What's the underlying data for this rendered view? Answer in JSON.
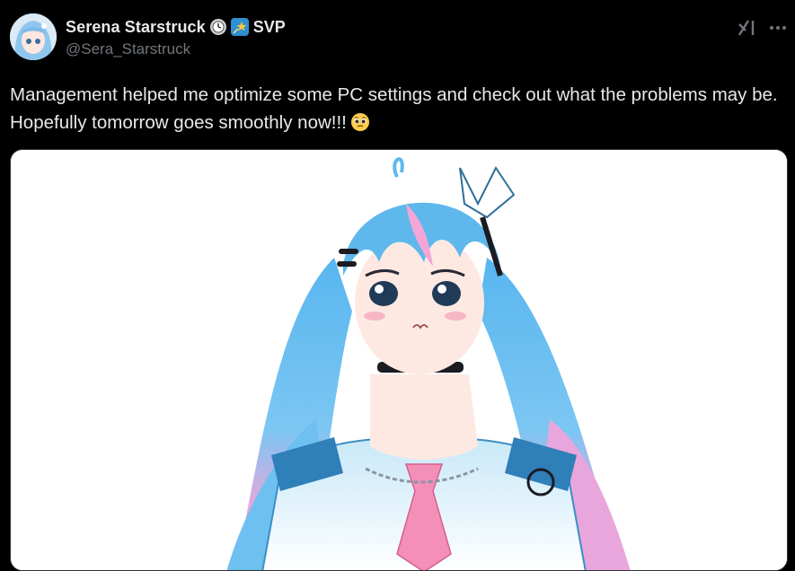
{
  "author": {
    "display_name": "Serena Starstruck",
    "badge_text": "SVP",
    "handle": "@Sera_Starstruck",
    "avatar_icon": "vtuber-avatar",
    "badges": [
      "clock-icon",
      "shooting-star-icon"
    ]
  },
  "actions": {
    "grok_icon": "grok-icon",
    "more_icon": "more-icon"
  },
  "post": {
    "text": "Management helped me optimize some PC settings and check out what the problems may be. Hopefully tomorrow goes smoothly now!!!",
    "emoji": "pleading-face-emoji"
  },
  "media": {
    "description_icon": "anime-girl-illustration"
  },
  "colors": {
    "background": "#000000",
    "text_primary": "#e7e9ea",
    "text_secondary": "#71767b",
    "hair_blue": "#5eb8ec",
    "hair_pink": "#f4a6d6"
  }
}
